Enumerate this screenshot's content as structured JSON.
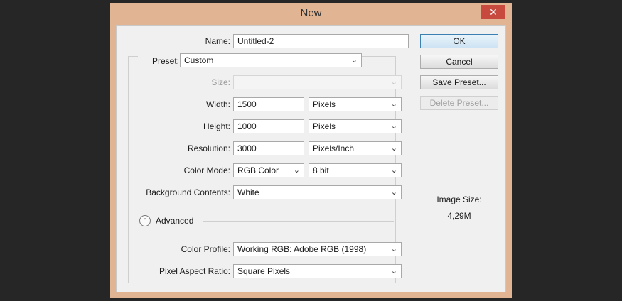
{
  "dialog": {
    "title": "New",
    "close_icon": "close-icon",
    "name_label": "Name:",
    "name_value": "Untitled-2",
    "preset_label": "Preset:",
    "preset_value": "Custom",
    "size_label": "Size:",
    "size_value": "",
    "width_label": "Width:",
    "width_value": "1500",
    "width_unit": "Pixels",
    "height_label": "Height:",
    "height_value": "1000",
    "height_unit": "Pixels",
    "resolution_label": "Resolution:",
    "resolution_value": "3000",
    "resolution_unit": "Pixels/Inch",
    "color_mode_label": "Color Mode:",
    "color_mode_value": "RGB Color",
    "bit_depth_value": "8 bit",
    "background_label": "Background Contents:",
    "background_value": "White",
    "advanced_label": "Advanced",
    "color_profile_label": "Color Profile:",
    "color_profile_value": "Working RGB:  Adobe RGB (1998)",
    "pixel_aspect_label": "Pixel Aspect Ratio:",
    "pixel_aspect_value": "Square Pixels"
  },
  "buttons": {
    "ok": "OK",
    "cancel": "Cancel",
    "save_preset": "Save Preset...",
    "delete_preset": "Delete Preset..."
  },
  "image_size": {
    "label": "Image Size:",
    "value": "4,29M"
  },
  "colors": {
    "frame": "#e1b493",
    "close": "#c84a3e",
    "backdrop": "#262626"
  }
}
